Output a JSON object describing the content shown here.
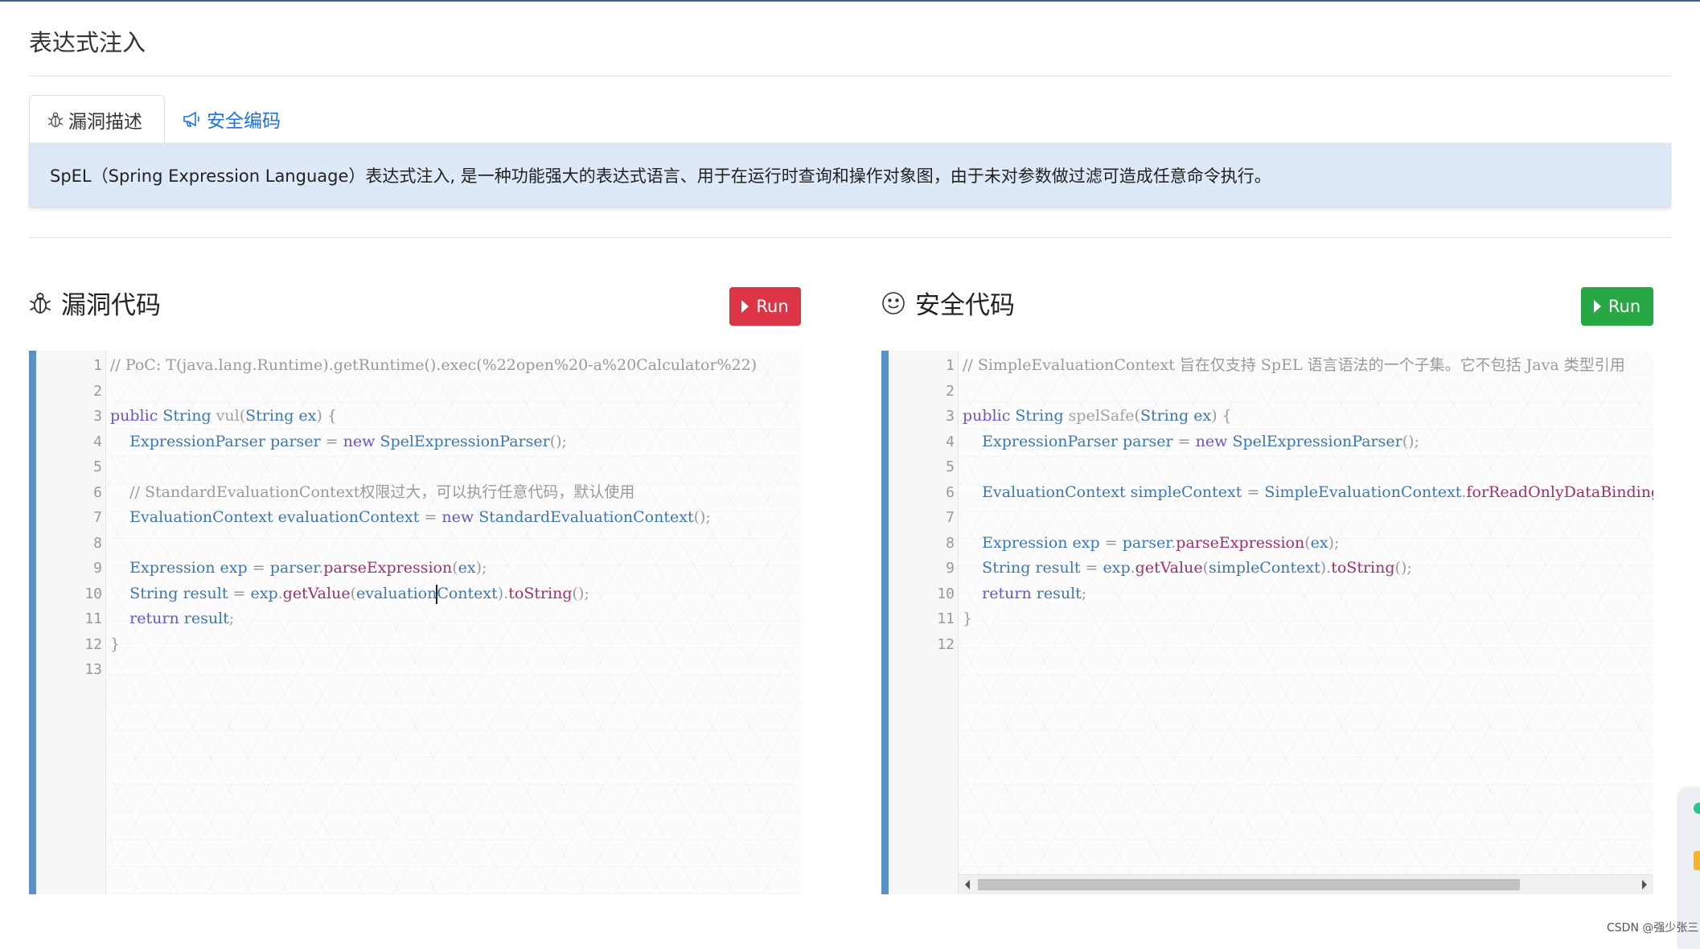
{
  "page": {
    "title": "表达式注入"
  },
  "tabs": [
    {
      "label": "漏洞描述",
      "icon": "bug-icon",
      "active": true
    },
    {
      "label": "安全编码",
      "icon": "megaphone-icon",
      "active": false
    }
  ],
  "description": "SpEL（Spring Expression Language）表达式注入, 是一种功能强大的表达式语言、用于在运行时查询和操作对象图，由于未对参数做过滤可造成任意命令执行。",
  "vuln": {
    "title": "漏洞代码",
    "icon": "bug-icon",
    "run_label": "Run",
    "line_numbers": [
      "1",
      "2",
      "3",
      "4",
      "5",
      "6",
      "7",
      "8",
      "9",
      "10",
      "11",
      "12",
      "13"
    ],
    "lines": [
      "// PoC: T(java.lang.Runtime).getRuntime().exec(%22open%20-a%20Calculator%22)",
      "",
      "public String vul(String ex) {",
      "    ExpressionParser parser = new SpelExpressionParser();",
      "",
      "    // StandardEvaluationContext权限过大，可以执行任意代码，默认使用",
      "    EvaluationContext evaluationContext = new StandardEvaluationContext();",
      "",
      "    Expression exp = parser.parseExpression(ex);",
      "    String result = exp.getValue(evaluationContext).toString();",
      "    return result;",
      "}",
      ""
    ]
  },
  "safe": {
    "title": "安全代码",
    "icon": "smile-icon",
    "run_label": "Run",
    "line_numbers": [
      "1",
      "2",
      "3",
      "4",
      "5",
      "6",
      "7",
      "8",
      "9",
      "10",
      "11",
      "12"
    ],
    "lines": [
      "// SimpleEvaluationContext 旨在仅支持 SpEL 语言语法的一个子集。它不包括 Java 类型引用",
      "",
      "public String spelSafe(String ex) {",
      "    ExpressionParser parser = new SpelExpressionParser();",
      "",
      "    EvaluationContext simpleContext = SimpleEvaluationContext.forReadOnlyDataBinding().build();",
      "",
      "    Expression exp = parser.parseExpression(ex);",
      "    String result = exp.getValue(simpleContext).toString();",
      "    return result;",
      "}",
      ""
    ]
  },
  "watermark": "CSDN @强少张三",
  "colors": {
    "run_vuln": "#dc3545",
    "run_safe": "#28a745",
    "editor_bar": "#5b8fc7",
    "desc_bg": "#dde9f7",
    "tab_link": "#1a73e8"
  }
}
